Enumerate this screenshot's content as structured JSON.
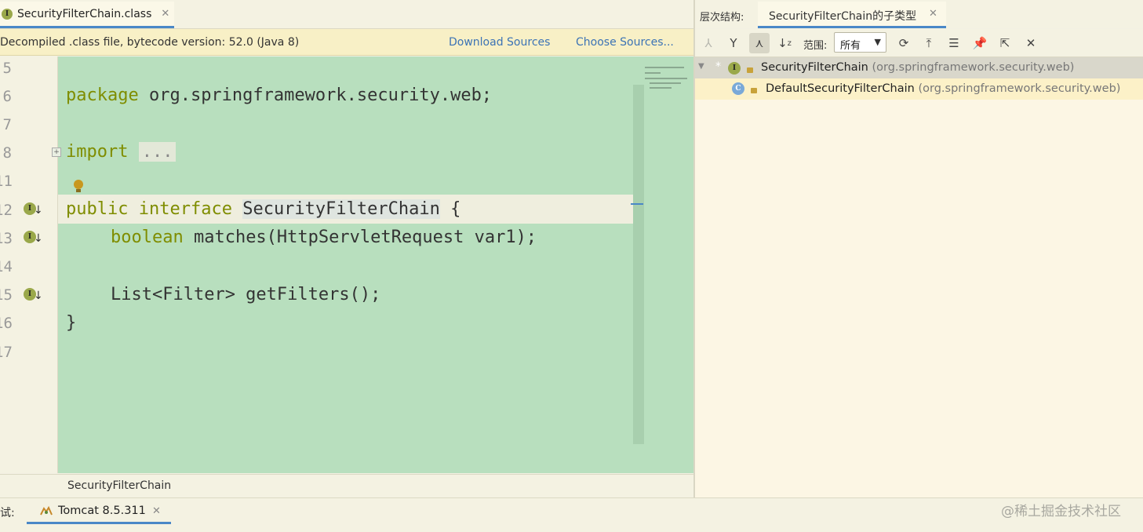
{
  "editor": {
    "tab": {
      "filename": "SecurityFilterChain.class",
      "icon": "interface-icon",
      "icon_letter": "I"
    },
    "notice": {
      "message": "Decompiled .class file, bytecode version: 52.0 (Java 8)",
      "download_sources": "Download Sources",
      "choose_sources": "Choose Sources..."
    },
    "line_numbers": [
      "5",
      "6",
      "7",
      "8",
      "11",
      "12",
      "13",
      "14",
      "15",
      "16",
      "17"
    ],
    "code": {
      "line6_kw": "package",
      "line6_rest": " org.springframework.security.web;",
      "line8_kw": "import",
      "line8_fold": "...",
      "line12_kw1": "public",
      "line12_kw2": "interface",
      "line12_name": "SecurityFilterChain",
      "line12_brace": " {",
      "line13_kw": "boolean",
      "line13_rest": " matches(HttpServletRequest var1);",
      "line15": "List<Filter> getFilters();",
      "line16": "}"
    },
    "breadcrumb": "SecurityFilterChain"
  },
  "hierarchy": {
    "title": "层次结构:",
    "tab_label": "SecurityFilterChain的子类型",
    "scope_label": "范围:",
    "scope_value": "所有",
    "tree": [
      {
        "name": "SecurityFilterChain",
        "package": "(org.springframework.security.web)",
        "icon": "interface-icon",
        "icon_letter": "I"
      },
      {
        "name": "DefaultSecurityFilterChain",
        "package": "(org.springframework.security.web)",
        "icon": "class-icon",
        "icon_letter": "C"
      }
    ]
  },
  "bottom": {
    "debug_label": "调试:",
    "run_tab": "Tomcat 8.5.311",
    "watermark": "@稀土掘金技术社区"
  },
  "colors": {
    "editor_bg": "#b8dfbe",
    "keyword": "#7f8d00",
    "link": "#3c73b5",
    "accent": "#4a88c7",
    "notice_bg": "#f8f0c6"
  }
}
